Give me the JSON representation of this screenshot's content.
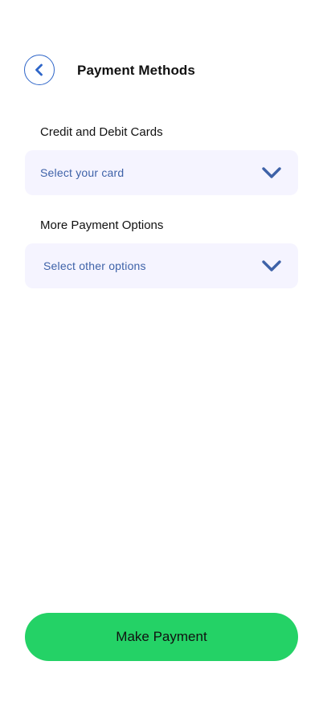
{
  "header": {
    "title": "Payment Methods",
    "back_icon": "chevron-left-icon"
  },
  "cards_section": {
    "label": "Credit and Debit Cards",
    "select_value": "Select your card",
    "icon": "chevron-down-icon"
  },
  "other_section": {
    "label": "More Payment Options",
    "select_value": "Select other options",
    "icon": "chevron-down-icon"
  },
  "footer": {
    "pay_label": "Make Payment"
  },
  "colors": {
    "accent_blue": "#2f66c9",
    "select_text": "#3e62a8",
    "select_bg": "#f5f4ff",
    "pay_button": "#24d266",
    "text": "#111111",
    "background": "#ffffff"
  }
}
